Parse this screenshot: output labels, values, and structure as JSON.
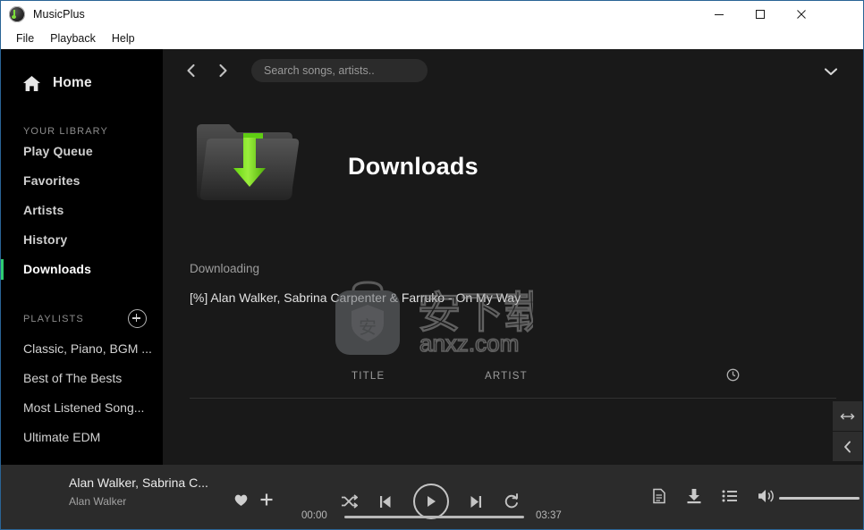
{
  "window": {
    "title": "MusicPlus",
    "app_icon": "music-note-icon",
    "controls": {
      "minimize": "minimize-icon",
      "maximize": "maximize-icon",
      "close": "close-icon"
    },
    "border_color": "#2a6496"
  },
  "menubar": {
    "items": [
      "File",
      "Playback",
      "Help"
    ]
  },
  "sidebar": {
    "home": {
      "label": "Home",
      "icon": "home-icon"
    },
    "library_heading": "YOUR LIBRARY",
    "library_items": [
      {
        "label": "Play Queue",
        "active": false
      },
      {
        "label": "Favorites",
        "active": false
      },
      {
        "label": "Artists",
        "active": false
      },
      {
        "label": "History",
        "active": false
      },
      {
        "label": "Downloads",
        "active": true
      }
    ],
    "playlists_heading": "PLAYLISTS",
    "add_playlist_icon": "plus-circle-icon",
    "playlists": [
      "Classic, Piano, BGM ...",
      "Best of The Bests",
      "Most Listened Song...",
      "Ultimate EDM"
    ],
    "accent_color": "#2ecc71"
  },
  "topbar": {
    "back_icon": "chevron-left-icon",
    "forward_icon": "chevron-right-icon",
    "search_placeholder": "Search songs, artists..",
    "search_value": "",
    "expand_icon": "chevron-down-icon"
  },
  "content": {
    "hero_icon": "downloads-folder-icon",
    "page_title": "Downloads",
    "download_status_label": "Downloading",
    "download_item": "[%] Alan Walker, Sabrina Carpenter & Farruko - On My Way",
    "table_headers": {
      "title": "TITLE",
      "artist": "ARTIST",
      "duration_icon": "clock-icon"
    },
    "rows": []
  },
  "dock": {
    "buttons": [
      {
        "icon": "resize-horizontal-icon"
      },
      {
        "icon": "chevron-left-icon"
      }
    ]
  },
  "watermark": {
    "text_cn": "安下载",
    "text_url": "anxz.com",
    "badge": "shield-bag-icon"
  },
  "player": {
    "track_title": "Alan Walker, Sabrina C...",
    "track_artist": "Alan Walker",
    "favorite_icon": "heart-icon",
    "add_icon": "plus-icon",
    "shuffle_icon": "shuffle-icon",
    "previous_icon": "skip-previous-icon",
    "play_icon": "play-icon",
    "next_icon": "skip-next-icon",
    "repeat_icon": "repeat-icon",
    "time_current": "00:00",
    "time_total": "03:37",
    "progress_percent": 0,
    "lyrics_icon": "document-icon",
    "download_icon": "download-icon",
    "queue_icon": "list-icon",
    "volume_icon": "speaker-icon",
    "volume_percent": 100
  }
}
